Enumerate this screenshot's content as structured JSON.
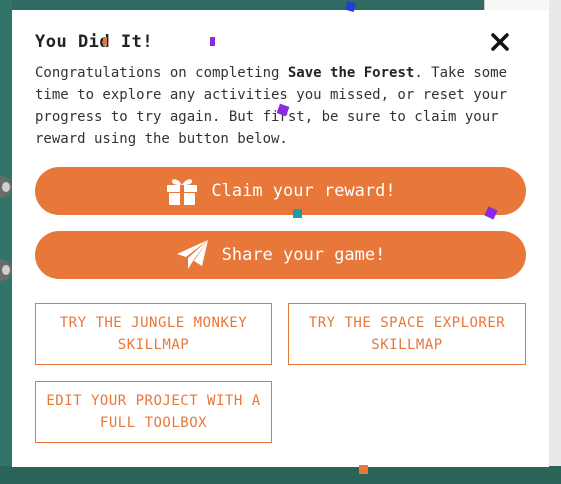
{
  "modal": {
    "title": "You Did It!",
    "close_icon": "close-icon",
    "message_prefix": "Congratulations on completing ",
    "game_name": "Save the Forest",
    "message_suffix": ". Take some time to explore any activities you missed, or reset your progress to try again. But first, be sure to claim your reward using the button below."
  },
  "buttons": {
    "claim": {
      "label": "Claim your reward!",
      "icon": "gift-icon"
    },
    "share": {
      "label": "Share your game!",
      "icon": "paper-plane-icon"
    },
    "jungle": "TRY THE JUNGLE MONKEY SKILLMAP",
    "space": "TRY THE SPACE EXPLORER SKILLMAP",
    "edit": "EDIT YOUR PROJECT WITH A FULL TOOLBOX"
  },
  "colors": {
    "accent": "#e8773a",
    "background": "#2f6b63",
    "modal": "#ffffff"
  }
}
